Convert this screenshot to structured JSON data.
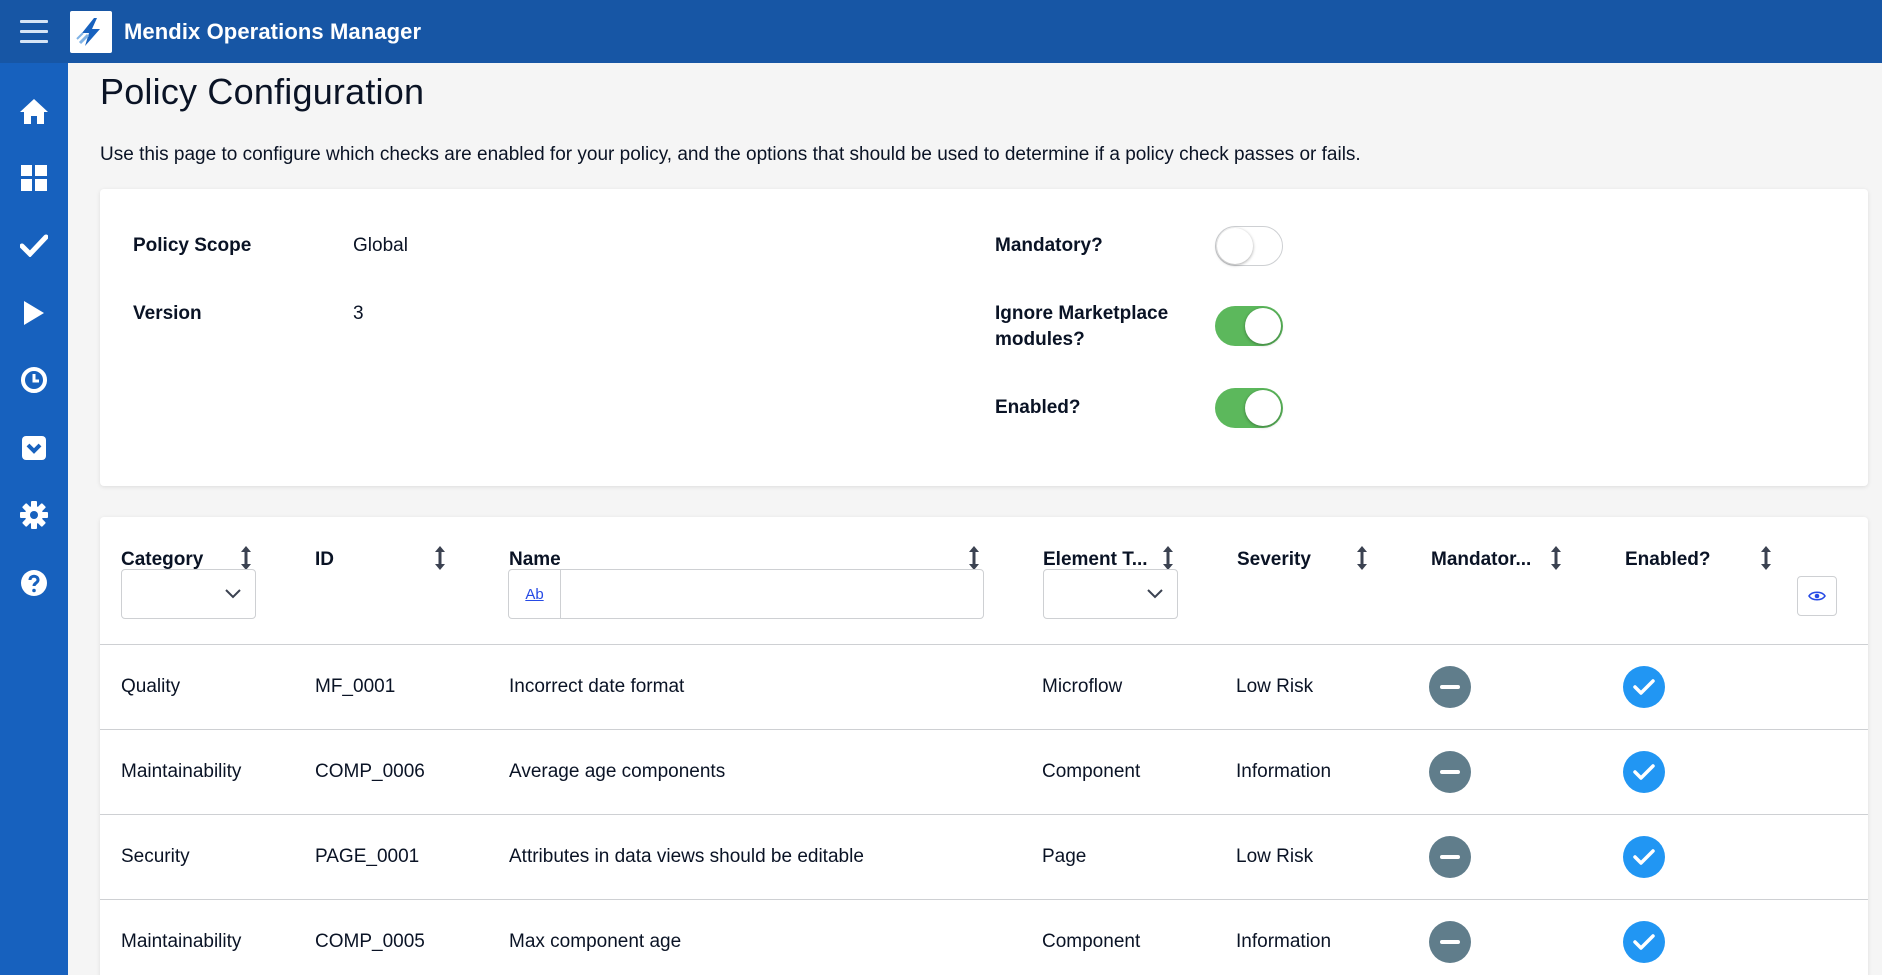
{
  "app": {
    "title": "Mendix Operations Manager",
    "colors": {
      "topbar": "#1756a5",
      "sidebar": "#1761be",
      "toggle_on": "#5cb85c",
      "enabled_icon": "#2196f3",
      "mandatory_icon": "#607d8b"
    }
  },
  "sidebar": {
    "items": [
      {
        "icon": "home-icon"
      },
      {
        "icon": "dashboard-icon"
      },
      {
        "icon": "checkmark-icon"
      },
      {
        "icon": "play-icon"
      },
      {
        "icon": "clock-icon"
      },
      {
        "icon": "inbox-icon"
      },
      {
        "icon": "gear-icon"
      },
      {
        "icon": "help-icon"
      }
    ]
  },
  "page": {
    "title": "Policy Configuration",
    "description": "Use this page to configure which checks are enabled for your policy, and the options that should be used to determine if a policy check passes or fails."
  },
  "policy": {
    "scope_label": "Policy Scope",
    "scope_value": "Global",
    "version_label": "Version",
    "version_value": "3",
    "mandatory_label": "Mandatory?",
    "mandatory_on": false,
    "ignore_label_line1": "Ignore Marketplace",
    "ignore_label_line2": "modules?",
    "ignore_on": true,
    "enabled_label": "Enabled?",
    "enabled_on": true
  },
  "grid": {
    "columns": [
      "Category",
      "ID",
      "Name",
      "Element T...",
      "Severity",
      "Mandator...",
      "Enabled?"
    ],
    "name_filter_button": "Ab",
    "name_filter_value": "",
    "rows": [
      {
        "category": "Quality",
        "id": "MF_0001",
        "name": "Incorrect date format",
        "element_type": "Microflow",
        "severity": "Low Risk",
        "mandatory": false,
        "enabled": true
      },
      {
        "category": "Maintainability",
        "id": "COMP_0006",
        "name": "Average age components",
        "element_type": "Component",
        "severity": "Information",
        "mandatory": false,
        "enabled": true
      },
      {
        "category": "Security",
        "id": "PAGE_0001",
        "name": "Attributes in data views should be editable",
        "element_type": "Page",
        "severity": "Low Risk",
        "mandatory": false,
        "enabled": true
      },
      {
        "category": "Maintainability",
        "id": "COMP_0005",
        "name": "Max component age",
        "element_type": "Component",
        "severity": "Information",
        "mandatory": false,
        "enabled": true
      }
    ]
  }
}
